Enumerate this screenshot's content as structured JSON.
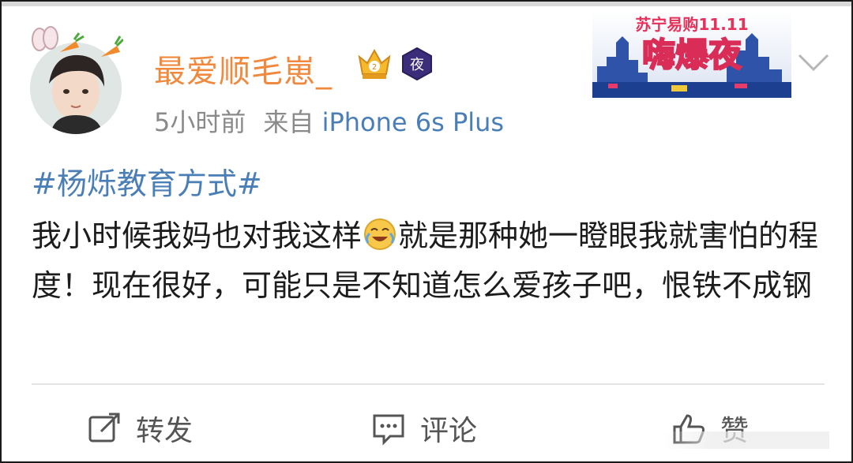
{
  "post": {
    "author": {
      "name": "最爱顺毛崽_",
      "name_color": "#f0883e",
      "badges": [
        "crown-icon",
        "night-badge-icon"
      ],
      "night_badge_char": "夜"
    },
    "meta": {
      "time": "5小时前",
      "source_prefix": "来自",
      "device": "iPhone 6s Plus"
    },
    "banner": {
      "top_text": "苏宁易购11.11",
      "main_text": "嗨爆夜"
    },
    "hashtag": "#杨烁教育方式#",
    "text_part1": "我小时候我妈也对我这样",
    "text_part2": "就是那种她一瞪眼我就害怕的程度！现在很好，可能只是不知道怎么爱孩子吧，恨铁不成钢",
    "emoji": "crying-laughing-emoji"
  },
  "actions": {
    "repost_label": "转发",
    "comment_label": "评论",
    "like_label": "赞"
  },
  "colors": {
    "link": "#4a7eb6",
    "meta": "#8a8a8a",
    "text": "#1c1c1c",
    "action": "#555555"
  }
}
